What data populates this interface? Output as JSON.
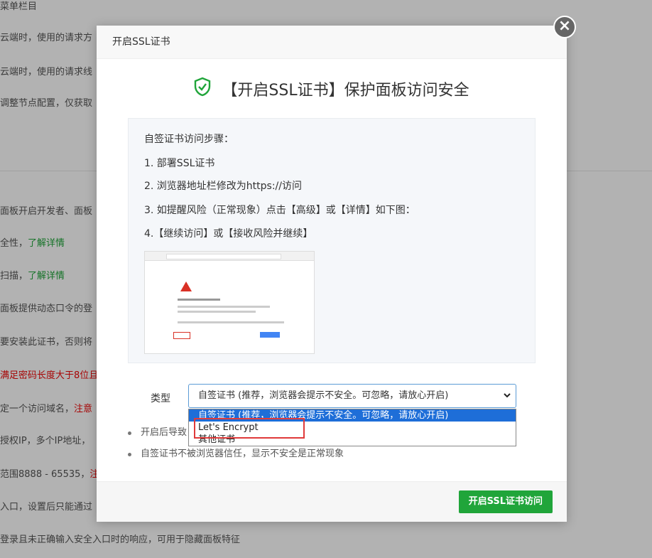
{
  "background": {
    "lines": [
      {
        "text": "菜单栏目"
      },
      {
        "text": "云端时，使用的请求方"
      },
      {
        "text": "云端时，使用的请求线"
      },
      {
        "text": "调整节点配置，仅获取"
      },
      {
        "text": "面板开启开发者、面板"
      },
      {
        "pre": "全性，",
        "link": "了解详情"
      },
      {
        "pre": "扫描，",
        "link": "了解详情"
      },
      {
        "text": "面板提供动态口令的登"
      },
      {
        "text": "要安装此证书，否则将"
      },
      {
        "red": "满足密码长度大于8位且"
      },
      {
        "pre": "定一个访问域名，",
        "red": "注意"
      },
      {
        "text": "授权IP，多个IP地址，"
      },
      {
        "pre": "范围8888 - 65535，",
        "red": "注"
      },
      {
        "text": "入口，设置后只能通过"
      },
      {
        "text": "登录且未正确输入安全入口时的响应，可用于隐藏面板特征"
      }
    ]
  },
  "modal": {
    "title": "开启SSL证书",
    "heading": "【开启SSL证书】保护面板访问安全",
    "steps": {
      "intro": "自签证书访问步骤：",
      "items": [
        "1. 部署SSL证书",
        "2. 浏览器地址栏修改为https://访问",
        "3. 如提醒风险（正常现象）点击【高级】或【详情】如下图：",
        "4.【继续访问】或【接收风险并继续】"
      ]
    },
    "type_label": "类型",
    "select_value": "自签证书 (推荐，浏览器会提示不安全。可忽略，请放心开启)",
    "options": [
      "自签证书 (推荐，浏览器会提示不安全。可忽略，请放心开启)",
      "Let's Encrypt",
      "其他证书"
    ],
    "notes": [
      "开启后导致",
      "自签证书不被浏览器信任，显示不安全是正常现象"
    ],
    "submit_label": "开启SSL证书访问",
    "close_symbol": "×"
  },
  "colors": {
    "accent": "#20a53a",
    "select_highlight": "#1e6ed8",
    "annotation": "#e03a3a"
  }
}
